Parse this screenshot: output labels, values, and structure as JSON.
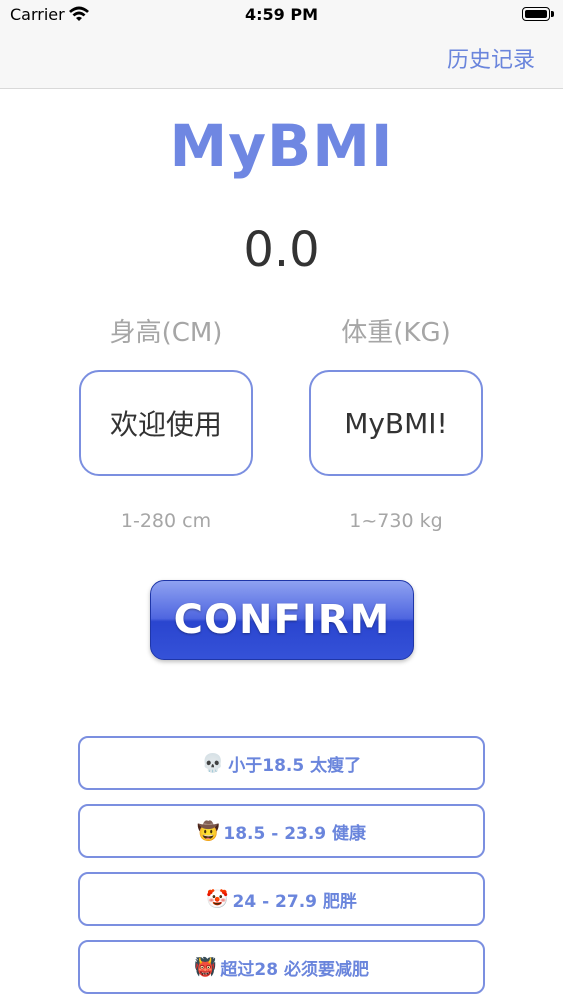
{
  "status_bar": {
    "carrier": "Carrier",
    "time": "4:59 PM"
  },
  "nav": {
    "history_label": "历史记录"
  },
  "app": {
    "title": "MyBMI",
    "bmi_value": "0.0"
  },
  "height": {
    "label": "身高(CM)",
    "value": "欢迎使用",
    "range": "1-280 cm"
  },
  "weight": {
    "label": "体重(KG)",
    "value": "MyBMI!",
    "range": "1~730 kg"
  },
  "confirm_label": "CONFIRM",
  "legend": [
    {
      "emoji": "💀",
      "text": "小于18.5  太瘦了"
    },
    {
      "emoji": "🤠",
      "text": "18.5 - 23.9  健康"
    },
    {
      "emoji": "🤡",
      "text": "24 - 27.9  肥胖"
    },
    {
      "emoji": "👹",
      "text": "超过28  必须要减肥"
    }
  ],
  "colors": {
    "accent": "#6f87e2",
    "border": "#7b8fe0",
    "button": "#3552d8"
  }
}
